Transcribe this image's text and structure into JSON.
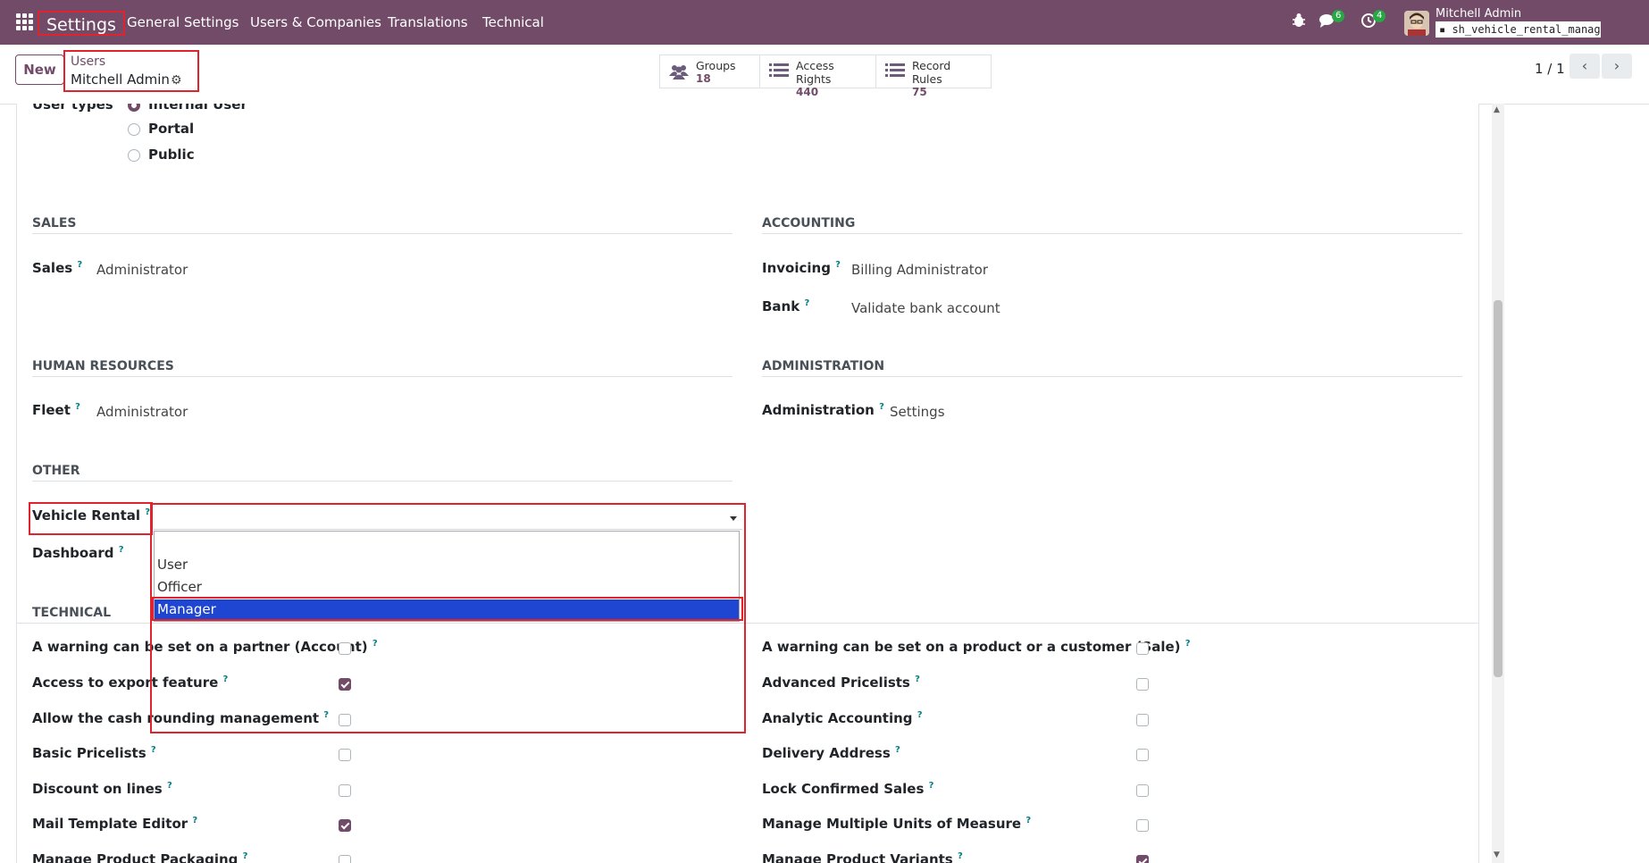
{
  "topbar": {
    "app": "Settings",
    "menu": [
      "General Settings",
      "Users & Companies",
      "Translations",
      "Technical"
    ],
    "chat_badge": "6",
    "activity_badge": "4",
    "user_name": "Mitchell Admin",
    "database": "sh_vehicle_rental_manage…"
  },
  "control": {
    "new_label": "New",
    "breadcrumb": "Users",
    "record": "Mitchell Admin",
    "stats": [
      {
        "label": "Groups",
        "value": "18"
      },
      {
        "label": "Access Rights",
        "value": "440"
      },
      {
        "label": "Record Rules",
        "value": "75"
      }
    ],
    "pager": "1 / 1"
  },
  "user_types": {
    "label": "User types",
    "options": [
      "Internal User",
      "Portal",
      "Public"
    ],
    "selected": "Internal User"
  },
  "sections": {
    "sales": "SALES",
    "accounting": "ACCOUNTING",
    "hr": "HUMAN RESOURCES",
    "administration": "ADMINISTRATION",
    "other": "OTHER",
    "technical": "TECHNICAL"
  },
  "fields": {
    "sales": {
      "label": "Sales",
      "value": "Administrator"
    },
    "invoicing": {
      "label": "Invoicing",
      "value": "Billing Administrator"
    },
    "bank": {
      "label": "Bank",
      "value": "Validate bank account"
    },
    "fleet": {
      "label": "Fleet",
      "value": "Administrator"
    },
    "administration": {
      "label": "Administration",
      "value": "Settings"
    },
    "vehicle_rental": {
      "label": "Vehicle Rental",
      "value": ""
    },
    "dashboard": {
      "label": "Dashboard"
    }
  },
  "dropdown_options": [
    "User",
    "Officer",
    "Manager"
  ],
  "dropdown_selected": "Manager",
  "help_mark": "?",
  "technical_left": [
    {
      "label": "A warning can be set on a partner (Account)",
      "checked": false
    },
    {
      "label": "Access to export feature",
      "checked": true
    },
    {
      "label": "Allow the cash rounding management",
      "checked": false
    },
    {
      "label": "Basic Pricelists",
      "checked": false
    },
    {
      "label": "Discount on lines",
      "checked": false
    },
    {
      "label": "Mail Template Editor",
      "checked": true
    },
    {
      "label": "Manage Product Packaging",
      "checked": false
    }
  ],
  "technical_right": [
    {
      "label": "A warning can be set on a product or a customer (Sale)",
      "checked": false
    },
    {
      "label": "Advanced Pricelists",
      "checked": false
    },
    {
      "label": "Analytic Accounting",
      "checked": false
    },
    {
      "label": "Delivery Address",
      "checked": false
    },
    {
      "label": "Lock Confirmed Sales",
      "checked": false
    },
    {
      "label": "Manage Multiple Units of Measure",
      "checked": false
    },
    {
      "label": "Manage Product Variants",
      "checked": true
    }
  ],
  "colors": {
    "brand": "#714B67",
    "highlight": "#1f46d2",
    "annotation": "#e0232c"
  }
}
